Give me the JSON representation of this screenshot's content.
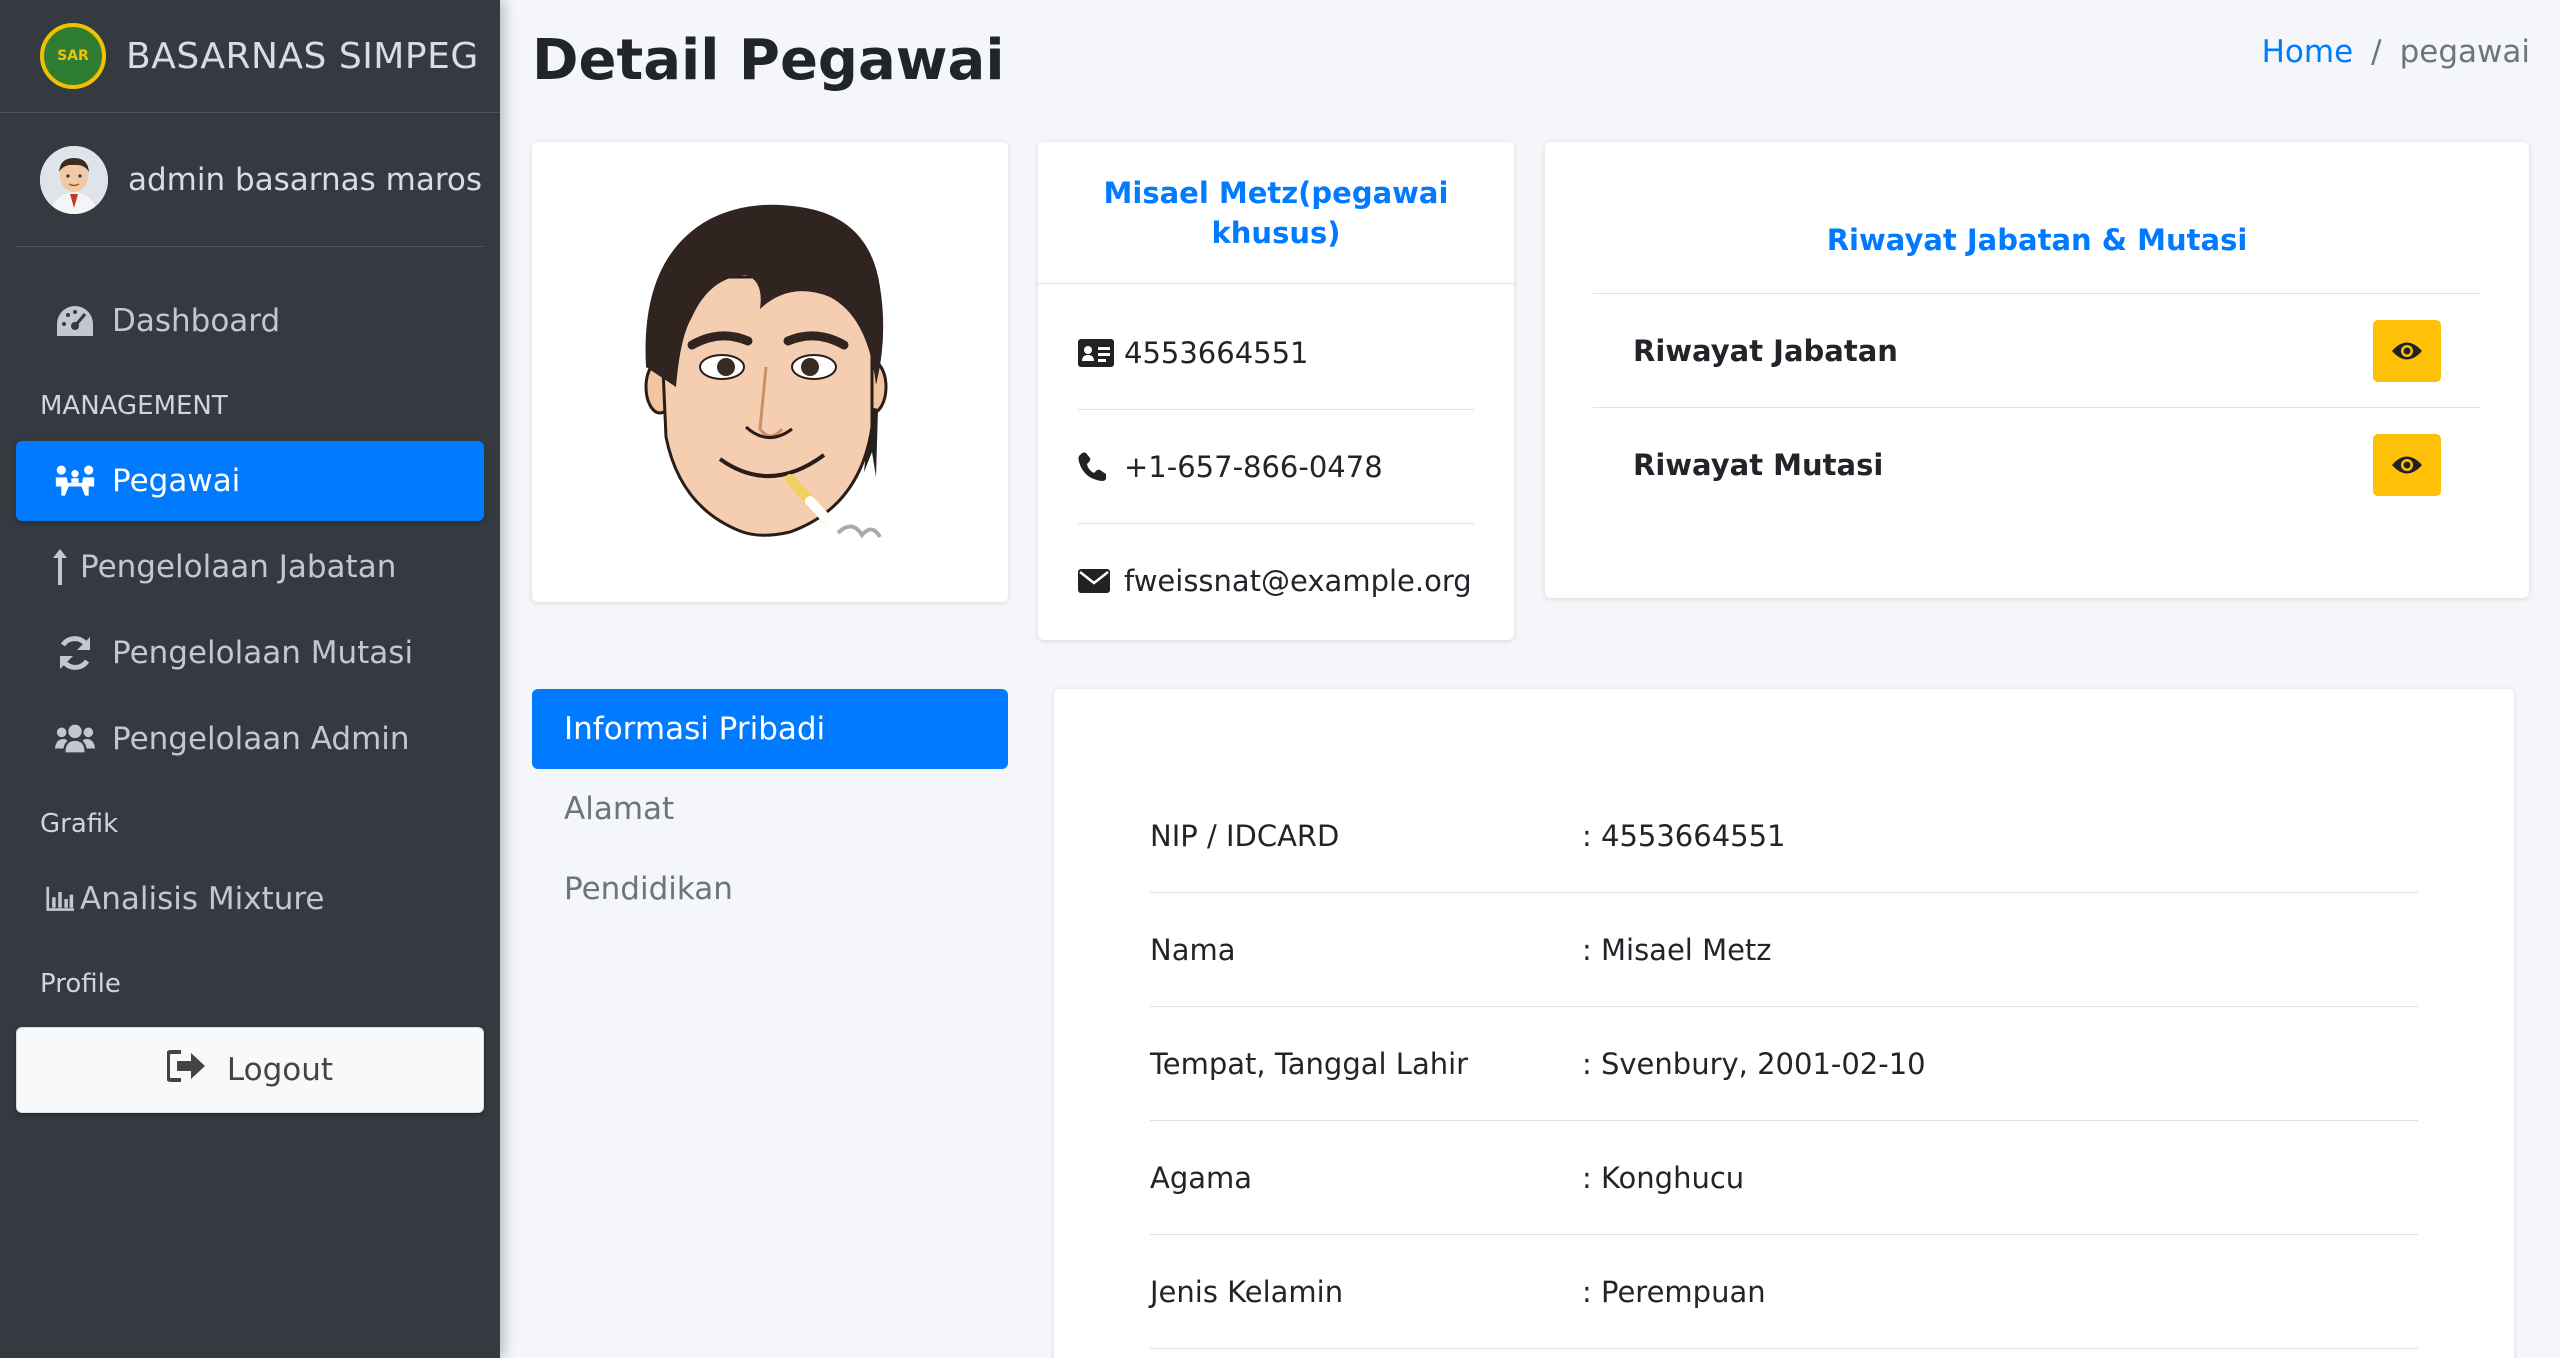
{
  "brand": {
    "name": "BASARNAS SIMPEG",
    "logo_text": "SAR"
  },
  "user": {
    "name": "admin basarnas maros"
  },
  "nav": {
    "dashboard": "Dashboard",
    "header_management": "MANAGEMENT",
    "pegawai": "Pegawai",
    "jabatan": "Pengelolaan Jabatan",
    "mutasi": "Pengelolaan Mutasi",
    "admin": "Pengelolaan Admin",
    "header_grafik": "Grafik",
    "analisis": "Analisis Mixture",
    "header_profile": "Profile",
    "logout": "Logout"
  },
  "page": {
    "title": "Detail Pegawai"
  },
  "breadcrumb": {
    "home": "Home",
    "sep": "/",
    "current": "pegawai"
  },
  "contact": {
    "name": "Misael Metz(pegawai khusus)",
    "id_card": "4553664551",
    "phone": "+1-657-866-0478",
    "email": "fweissnat@example.org"
  },
  "riwayat": {
    "title": "Riwayat Jabatan & Mutasi",
    "jabatan": "Riwayat Jabatan",
    "mutasi": "Riwayat Mutasi"
  },
  "tabs": [
    "Informasi Pribadi",
    "Alamat",
    "Pendidikan"
  ],
  "info": [
    {
      "label": "NIP / IDCARD",
      "value": ": 4553664551"
    },
    {
      "label": "Nama",
      "value": ": Misael Metz"
    },
    {
      "label": "Tempat, Tanggal Lahir",
      "value": ": Svenbury, 2001-02-10"
    },
    {
      "label": "Agama",
      "value": ": Konghucu"
    },
    {
      "label": "Jenis Kelamin",
      "value": ": Perempuan"
    }
  ],
  "colors": {
    "primary": "#007bff",
    "sidebar": "#343a40",
    "warning": "#ffc107"
  }
}
